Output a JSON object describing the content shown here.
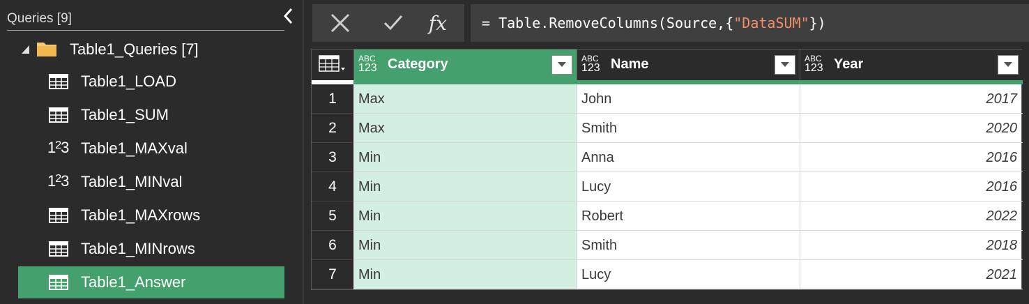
{
  "queries": {
    "title": "Queries [9]",
    "group": {
      "label": "Table1_Queries [7]",
      "icon": "folder-icon",
      "expanded": true
    },
    "items": [
      {
        "label": "Table1_LOAD",
        "icon": "table-icon",
        "selected": false
      },
      {
        "label": "Table1_SUM",
        "icon": "table-icon",
        "selected": false
      },
      {
        "label": "Table1_MAXval",
        "icon": "number-icon",
        "selected": false
      },
      {
        "label": "Table1_MINval",
        "icon": "number-icon",
        "selected": false
      },
      {
        "label": "Table1_MAXrows",
        "icon": "table-icon",
        "selected": false
      },
      {
        "label": "Table1_MINrows",
        "icon": "table-icon",
        "selected": false
      },
      {
        "label": "Table1_Answer",
        "icon": "table-icon",
        "selected": true
      }
    ]
  },
  "formula": {
    "prefix": "= Table.RemoveColumns(Source,{",
    "string": "\"DataSUM\"",
    "suffix": "})",
    "fx_label": "fx"
  },
  "grid": {
    "columns": [
      {
        "name": "Category",
        "type_top": "ABC",
        "type_bottom": "123",
        "active": true
      },
      {
        "name": "Name",
        "type_top": "ABC",
        "type_bottom": "123",
        "active": false
      },
      {
        "name": "Year",
        "type_top": "ABC",
        "type_bottom": "123",
        "active": false
      }
    ],
    "rows": [
      {
        "num": "1",
        "category": "Max",
        "name": "John",
        "year": "2017"
      },
      {
        "num": "2",
        "category": "Max",
        "name": "Smith",
        "year": "2020"
      },
      {
        "num": "3",
        "category": "Min",
        "name": "Anna",
        "year": "2016"
      },
      {
        "num": "4",
        "category": "Min",
        "name": "Lucy",
        "year": "2016"
      },
      {
        "num": "5",
        "category": "Min",
        "name": "Robert",
        "year": "2022"
      },
      {
        "num": "6",
        "category": "Min",
        "name": "Smith",
        "year": "2018"
      },
      {
        "num": "7",
        "category": "Min",
        "name": "Lucy",
        "year": "2021"
      }
    ]
  },
  "colors": {
    "accent": "#44a06c",
    "selected_column_bg": "#d3efe1",
    "pane_bg": "#2b2b2b",
    "string_literal": "#f08f6a"
  }
}
